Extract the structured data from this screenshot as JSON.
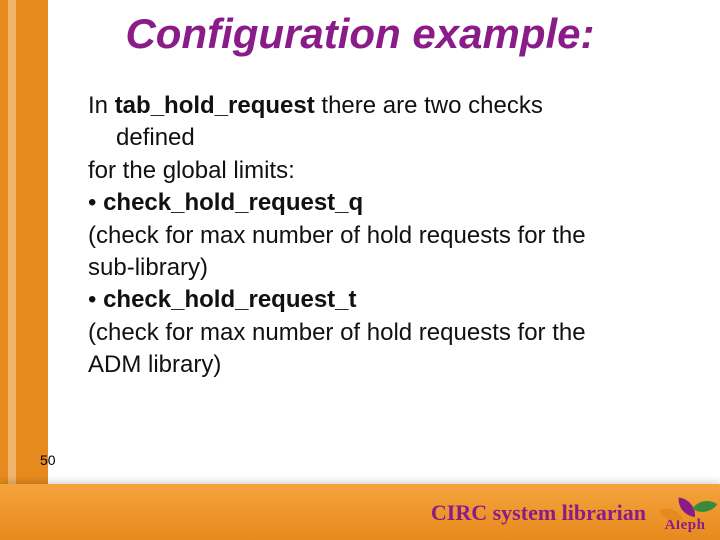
{
  "title": "Configuration example:",
  "body": {
    "line1a": "In ",
    "line1b": "tab_hold_request",
    "line1c": " there are two checks",
    "line1d": "defined",
    "line2": "for the global limits:",
    "bullet1_prefix": "• ",
    "bullet1": "check_hold_request_q",
    "explain1a": "(check for max number of hold requests for the",
    "explain1b": "sub-library)",
    "bullet2_prefix": "• ",
    "bullet2": "check_hold_request_t",
    "explain2a": "(check for max number of hold requests for the",
    "explain2b": "ADM library)"
  },
  "page_number": "50",
  "footer": "CIRC system librarian",
  "logo_text": "Aleph"
}
